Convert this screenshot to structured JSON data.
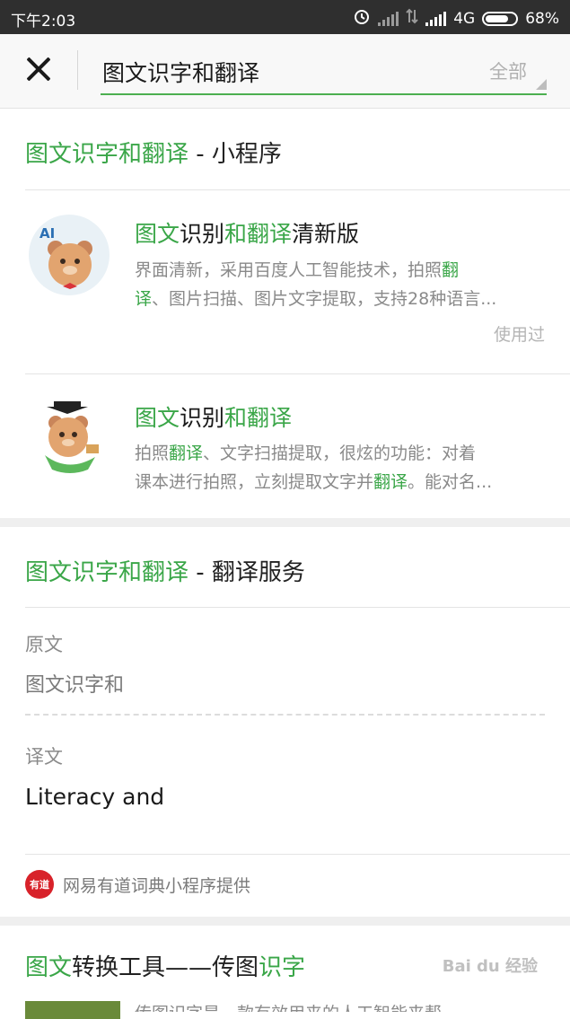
{
  "status_bar": {
    "time": "下午2:03",
    "network": "4G",
    "battery": "68%",
    "battery_level": 0.68,
    "icons": [
      "alarm-icon",
      "signal-icon",
      "data-arrows-icon",
      "signal-icon",
      "battery-icon"
    ]
  },
  "search": {
    "query": "图文识字和翻译",
    "scope": "全部"
  },
  "mini_program_section": {
    "title_hl": "图文识字和翻译",
    "title_rest": " - 小程序",
    "apps": [
      {
        "name_parts": [
          "图文",
          "识别",
          "和翻译",
          "清新版"
        ],
        "desc_parts": [
          "界面清新，采用百度人工智能技术，拍照",
          "翻",
          "译",
          "、图片扫描、图片文字提取，支持28种语言..."
        ],
        "used": "使用过",
        "icon_text": "AI"
      },
      {
        "name_parts": [
          "图文",
          "识别",
          "和翻译"
        ],
        "desc_parts": [
          "拍照",
          "翻译",
          "、文字扫描提取，很炫的功能：对着",
          "课本进行拍照，立刻提取文字并",
          "翻译",
          "。能对名..."
        ]
      }
    ]
  },
  "translation_section": {
    "title_hl": "图文识字和翻译",
    "title_rest": " - 翻译服务",
    "source_label": "原文",
    "source_text": "图文识字和",
    "target_label": "译文",
    "target_text": "Literacy and",
    "provider_logo": "有道",
    "provider_text": "网易有道词典小程序提供"
  },
  "article_section": {
    "title_parts": [
      "图文",
      "转换工具——传图",
      "识字"
    ],
    "snippet": "传图识字是一款有效用来的人工智能来帮"
  },
  "watermark": "Bai du 经验",
  "colors": {
    "highlight": "#3aa648",
    "status_bg": "#2f2f2f",
    "search_bg": "#f8f8f8"
  }
}
